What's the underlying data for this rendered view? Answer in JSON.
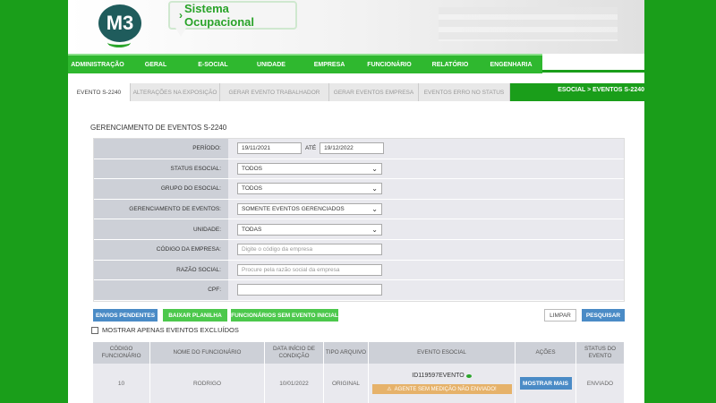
{
  "app": {
    "logo_text": "M3",
    "brand_arrow": "›",
    "brand_name": "Sistema Ocupacional"
  },
  "main_nav": [
    "ADMINISTRAÇÃO",
    "GERAL",
    "E-SOCIAL",
    "UNIDADE",
    "EMPRESA",
    "FUNCIONÁRIO",
    "RELATÓRIO",
    "ENGENHARIA"
  ],
  "sub_tabs": [
    "EVENTO S-2240",
    "ALTERAÇÕES NA EXPOSIÇÃO",
    "GERAR EVENTO TRABALHADOR",
    "GERAR EVENTOS EMPRESA",
    "EVENTOS ERRO NO STATUS"
  ],
  "breadcrumb": "ESOCIAL > EVENTOS S-2240",
  "page_title": "GERENCIAMENTO DE EVENTOS S-2240",
  "form": {
    "periodo_label": "PERÍODO:",
    "periodo_from": "19/11/2021",
    "ate_label": "ATÉ",
    "periodo_to": "19/12/2022",
    "status_label": "STATUS ESOCIAL:",
    "status_value": "TODOS",
    "grupo_label": "GRUPO DO ESOCIAL:",
    "grupo_value": "TODOS",
    "gerenc_label": "GERENCIAMENTO DE EVENTOS:",
    "gerenc_value": "SOMENTE EVENTOS GERENCIADOS",
    "unidade_label": "UNIDADE:",
    "unidade_value": "TODAS",
    "codigo_label": "CÓDIGO DA EMPRESA:",
    "codigo_placeholder": "Digite o código da empresa",
    "razao_label": "RAZÃO SOCIAL:",
    "razao_placeholder": "Procure pela razão social da empresa",
    "cpf_label": "CPF:",
    "cpf_value": ""
  },
  "buttons": {
    "envios": "ENVIOS PENDENTES",
    "baixar": "BAIXAR PLANILHA",
    "funcionarios": "FUNCIONÁRIOS SEM EVENTO INICIAL",
    "limpar": "LIMPAR",
    "pesquisar": "PESQUISAR"
  },
  "checkbox_label": "MOSTRAR APENAS EVENTOS EXCLUÍDOS",
  "table": {
    "headers": [
      "CÓDIGO FUNCIONÁRIO",
      "NOME DO FUNCIONÁRIO",
      "DATA INÍCIO DE CONDIÇÃO",
      "TIPO ARQUIVO",
      "EVENTO ESOCIAL",
      "AÇÕES",
      "STATUS DO EVENTO"
    ],
    "rows": [
      {
        "codigo": "10",
        "nome": "RODRIGO",
        "data": "10/01/2022",
        "tipo": "ORIGINAL",
        "evento_id": "ID119597EVENTO",
        "aviso": "AGENTE SEM MEDIÇÃO NÃO ENVIADO!",
        "acao": "MOSTRAR MAIS",
        "status": "ENVIADO"
      }
    ]
  },
  "colors": {
    "green": "#2fb82f",
    "dark_green": "#1a9e1a",
    "blue": "#4a8bc6",
    "warning": "#e6b26a"
  }
}
